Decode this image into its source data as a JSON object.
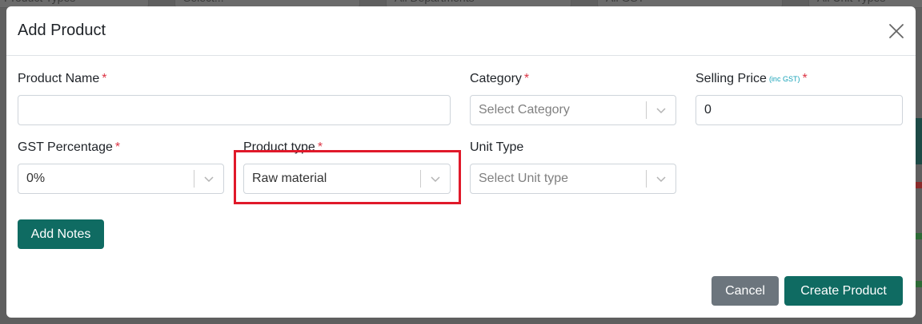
{
  "background": {
    "filters": [
      "Product Types",
      "Select...",
      "All Departments",
      "All GST",
      "All Unit Types"
    ]
  },
  "modal": {
    "title": "Add Product",
    "close_icon": "close-icon"
  },
  "fields": {
    "product_name": {
      "label": "Product Name",
      "required": "*",
      "value": ""
    },
    "category": {
      "label": "Category",
      "required": "*",
      "placeholder": "Select Category"
    },
    "selling_price": {
      "label": "Selling Price",
      "note": "(inc GST)",
      "required": "*",
      "value": "0"
    },
    "gst_percentage": {
      "label": "GST Percentage",
      "required": "*",
      "value": "0%"
    },
    "product_type": {
      "label": "Product type",
      "required": "*",
      "value": "Raw material"
    },
    "unit_type": {
      "label": "Unit Type",
      "placeholder": "Select Unit type"
    }
  },
  "buttons": {
    "add_notes": "Add Notes",
    "cancel": "Cancel",
    "create": "Create Product"
  },
  "colors": {
    "primary": "#0f6b62",
    "secondary": "#6c757d",
    "required": "#dc3545",
    "note": "#17a2b8",
    "highlight": "#e0192a"
  }
}
